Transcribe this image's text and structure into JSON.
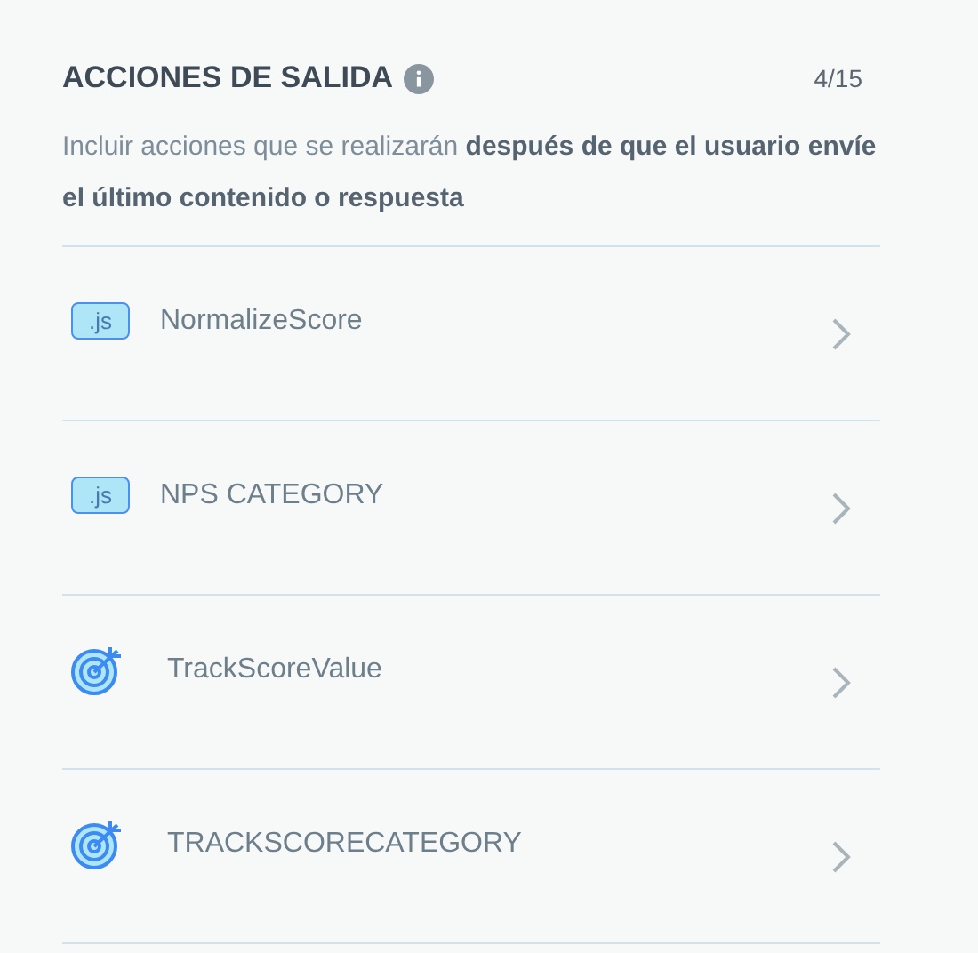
{
  "section": {
    "title": "ACCIONES DE SALIDA",
    "count": "4/15",
    "description": "Incluir acciones que se realizarán **después de que el usuario envíe el último contenido o respuesta**"
  },
  "actions": [
    {
      "kind": "script",
      "badge": ".js",
      "name": "NormalizeScore"
    },
    {
      "kind": "script",
      "badge": ".js",
      "name": "NPS CATEGORY"
    },
    {
      "kind": "target",
      "name": "TrackScoreValue"
    },
    {
      "kind": "target",
      "name": "TRACKSCORECATEGORY"
    }
  ]
}
